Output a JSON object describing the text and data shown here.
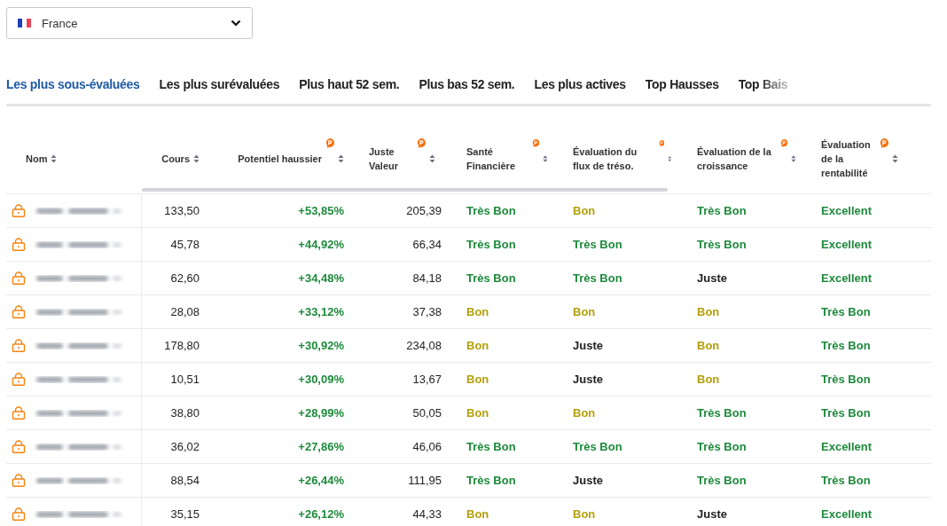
{
  "country_select": {
    "value": "France"
  },
  "tabs": [
    {
      "label": "Les plus sous-évaluées",
      "selected": true
    },
    {
      "label": "Les plus surévaluées",
      "selected": false
    },
    {
      "label": "Plus haut 52 sem.",
      "selected": false
    },
    {
      "label": "Plus bas 52 sem.",
      "selected": false
    },
    {
      "label": "Les plus actives",
      "selected": false
    },
    {
      "label": "Top Hausses",
      "selected": false
    },
    {
      "label": "Top Bais",
      "selected": false
    }
  ],
  "table": {
    "columns": [
      {
        "label": "Nom",
        "pro": false
      },
      {
        "label": "Cours",
        "pro": false
      },
      {
        "label": "Potentiel haussier",
        "pro": true
      },
      {
        "label": "Juste Valeur",
        "pro": true
      },
      {
        "label": "Santé Financière",
        "pro": true
      },
      {
        "label": "Évaluation du flux de tréso.",
        "pro": true
      },
      {
        "label": "Évaluation de la croissance",
        "pro": true
      },
      {
        "label": "Évaluation de la rentabilité",
        "pro": true
      }
    ],
    "rows": [
      {
        "locked": true,
        "price": "133,50",
        "upside": "+53,85%",
        "fair_value": "205,39",
        "ratings": [
          {
            "text": "Très Bon",
            "color": "#1e8a3c"
          },
          {
            "text": "Bon",
            "color": "#b3a00c"
          },
          {
            "text": "Très Bon",
            "color": "#1e8a3c"
          },
          {
            "text": "Excellent",
            "color": "#1e8a3c"
          }
        ]
      },
      {
        "locked": true,
        "price": "45,78",
        "upside": "+44,92%",
        "fair_value": "66,34",
        "ratings": [
          {
            "text": "Très Bon",
            "color": "#1e8a3c"
          },
          {
            "text": "Très Bon",
            "color": "#1e8a3c"
          },
          {
            "text": "Très Bon",
            "color": "#1e8a3c"
          },
          {
            "text": "Excellent",
            "color": "#1e8a3c"
          }
        ]
      },
      {
        "locked": true,
        "price": "62,60",
        "upside": "+34,48%",
        "fair_value": "84,18",
        "ratings": [
          {
            "text": "Très Bon",
            "color": "#1e8a3c"
          },
          {
            "text": "Très Bon",
            "color": "#1e8a3c"
          },
          {
            "text": "Juste",
            "color": "#222222"
          },
          {
            "text": "Excellent",
            "color": "#1e8a3c"
          }
        ]
      },
      {
        "locked": true,
        "price": "28,08",
        "upside": "+33,12%",
        "fair_value": "37,38",
        "ratings": [
          {
            "text": "Bon",
            "color": "#b3a00c"
          },
          {
            "text": "Bon",
            "color": "#b3a00c"
          },
          {
            "text": "Bon",
            "color": "#b3a00c"
          },
          {
            "text": "Très Bon",
            "color": "#1e8a3c"
          }
        ]
      },
      {
        "locked": true,
        "price": "178,80",
        "upside": "+30,92%",
        "fair_value": "234,08",
        "ratings": [
          {
            "text": "Bon",
            "color": "#b3a00c"
          },
          {
            "text": "Juste",
            "color": "#222222"
          },
          {
            "text": "Bon",
            "color": "#b3a00c"
          },
          {
            "text": "Très Bon",
            "color": "#1e8a3c"
          }
        ]
      },
      {
        "locked": true,
        "price": "10,51",
        "upside": "+30,09%",
        "fair_value": "13,67",
        "ratings": [
          {
            "text": "Bon",
            "color": "#b3a00c"
          },
          {
            "text": "Juste",
            "color": "#222222"
          },
          {
            "text": "Bon",
            "color": "#b3a00c"
          },
          {
            "text": "Très Bon",
            "color": "#1e8a3c"
          }
        ]
      },
      {
        "locked": true,
        "price": "38,80",
        "upside": "+28,99%",
        "fair_value": "50,05",
        "ratings": [
          {
            "text": "Bon",
            "color": "#b3a00c"
          },
          {
            "text": "Bon",
            "color": "#b3a00c"
          },
          {
            "text": "Très Bon",
            "color": "#1e8a3c"
          },
          {
            "text": "Très Bon",
            "color": "#1e8a3c"
          }
        ]
      },
      {
        "locked": true,
        "price": "36,02",
        "upside": "+27,86%",
        "fair_value": "46,06",
        "ratings": [
          {
            "text": "Très Bon",
            "color": "#1e8a3c"
          },
          {
            "text": "Très Bon",
            "color": "#1e8a3c"
          },
          {
            "text": "Très Bon",
            "color": "#1e8a3c"
          },
          {
            "text": "Excellent",
            "color": "#1e8a3c"
          }
        ]
      },
      {
        "locked": true,
        "price": "88,54",
        "upside": "+26,44%",
        "fair_value": "111,95",
        "ratings": [
          {
            "text": "Très Bon",
            "color": "#1e8a3c"
          },
          {
            "text": "Juste",
            "color": "#222222"
          },
          {
            "text": "Très Bon",
            "color": "#1e8a3c"
          },
          {
            "text": "Très Bon",
            "color": "#1e8a3c"
          }
        ]
      },
      {
        "locked": true,
        "price": "35,15",
        "upside": "+26,12%",
        "fair_value": "44,33",
        "ratings": [
          {
            "text": "Bon",
            "color": "#b3a00c"
          },
          {
            "text": "Bon",
            "color": "#b3a00c"
          },
          {
            "text": "Juste",
            "color": "#222222"
          },
          {
            "text": "Excellent",
            "color": "#1e8a3c"
          }
        ]
      }
    ]
  }
}
